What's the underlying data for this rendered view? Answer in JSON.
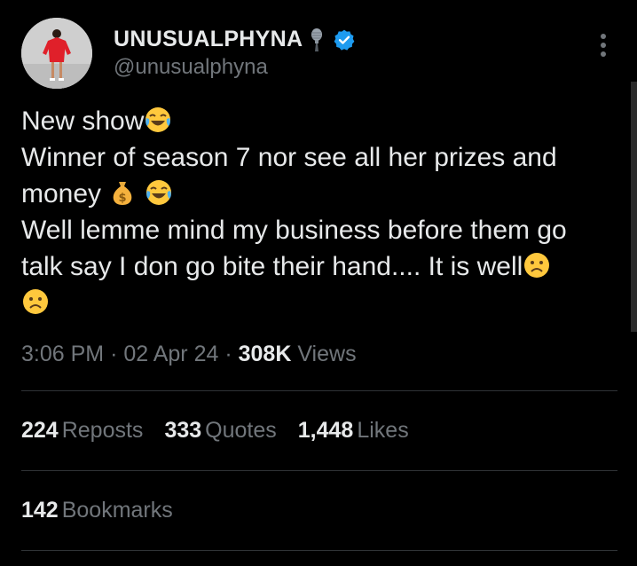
{
  "author": {
    "display_name": "UNUSUALPHYNA",
    "handle": "@unusualphyna",
    "avatar_icon": "profile-photo-woman-red-dress",
    "badge_emoji": "microphone-emoji",
    "verified_icon": "verified-badge-icon",
    "verified_color": "#1d9bf0"
  },
  "tweet": {
    "lines": [
      "New show",
      "Winner of season 7 nor see all her prizes and",
      "money ",
      "Well lemme mind my business before them go",
      "talk say I don go bite their hand.... It is well",
      ""
    ],
    "emojis": {
      "line1": "face-with-tears-of-joy-emoji",
      "line3": [
        "money-bag-emoji",
        "face-with-tears-of-joy-emoji"
      ],
      "line5": "frowning-face-emoji",
      "line6": "frowning-face-emoji"
    }
  },
  "meta": {
    "time": "3:06 PM",
    "separator": "·",
    "date": "02 Apr 24",
    "views_count": "308K",
    "views_label": "Views"
  },
  "stats": {
    "reposts_count": "224",
    "reposts_label": "Reposts",
    "quotes_count": "333",
    "quotes_label": "Quotes",
    "likes_count": "1,448",
    "likes_label": "Likes",
    "bookmarks_count": "142",
    "bookmarks_label": "Bookmarks"
  },
  "colors": {
    "background": "#000000",
    "primary_text": "#e7e9ea",
    "secondary_text": "#71767b",
    "divider": "#2f3336",
    "emoji_yellow": "#ffc83d"
  }
}
